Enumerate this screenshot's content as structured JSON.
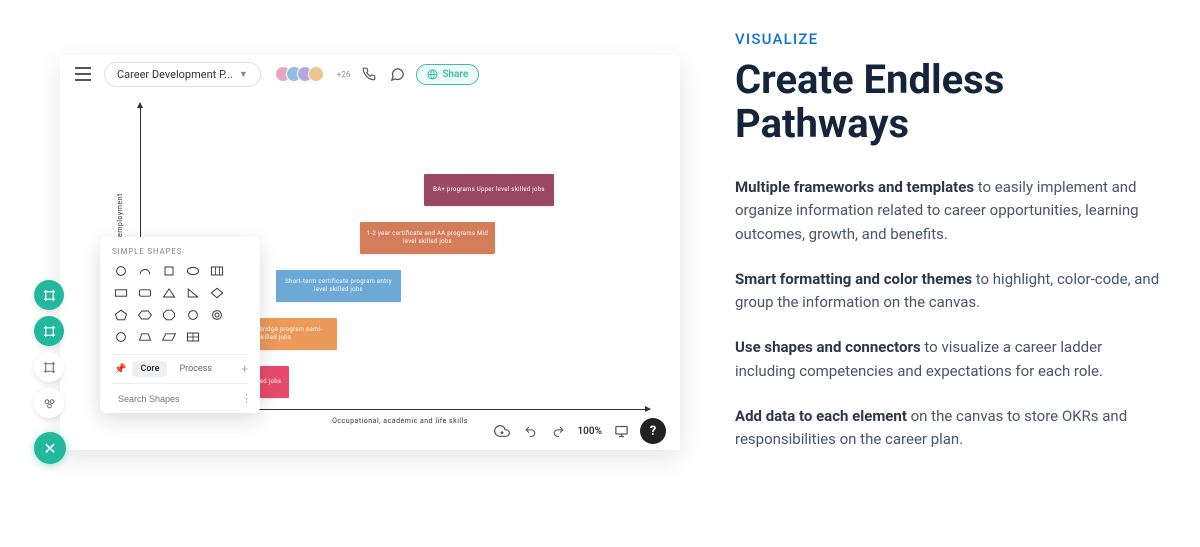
{
  "topbar": {
    "doc_title": "Career Development P...",
    "more_count": "+26",
    "share_label": "Share"
  },
  "canvas": {
    "y_axis_label": "Prospects for good-paying, stable employment",
    "x_axis_label": "Occupational, academic and life skills",
    "steps": [
      "Basic bridge programs  Unskilled jobs",
      "Secondary bridge program  semi-skilled jobs",
      "Short-term certificate program  entry level skilled jobs",
      "1-2 year certificate and AA programs  Mid level skilled jobs",
      "BA+ programs  Upper level skilled jobs"
    ]
  },
  "shapes_panel": {
    "title": "SIMPLE SHAPES",
    "tab_core": "Core",
    "tab_process": "Process",
    "search_placeholder": "Search Shapes"
  },
  "status": {
    "zoom": "100%"
  },
  "marketing": {
    "eyebrow": "VISUALIZE",
    "heading": "Create Endless Pathways",
    "p1_bold": "Multiple frameworks and templates",
    "p1_rest": " to easily implement and organize information related to career opportunities, learning outcomes, growth, and benefits.",
    "p2_bold": "Smart formatting and color themes",
    "p2_rest": " to highlight, color-code, and group the information on the canvas.",
    "p3_bold": "Use shapes and connectors",
    "p3_rest": " to visualize a career ladder including competencies and expectations for each role.",
    "p4_bold": "Add data to each element",
    "p4_rest": " on the canvas to store OKRs and responsibilities on the career plan."
  }
}
